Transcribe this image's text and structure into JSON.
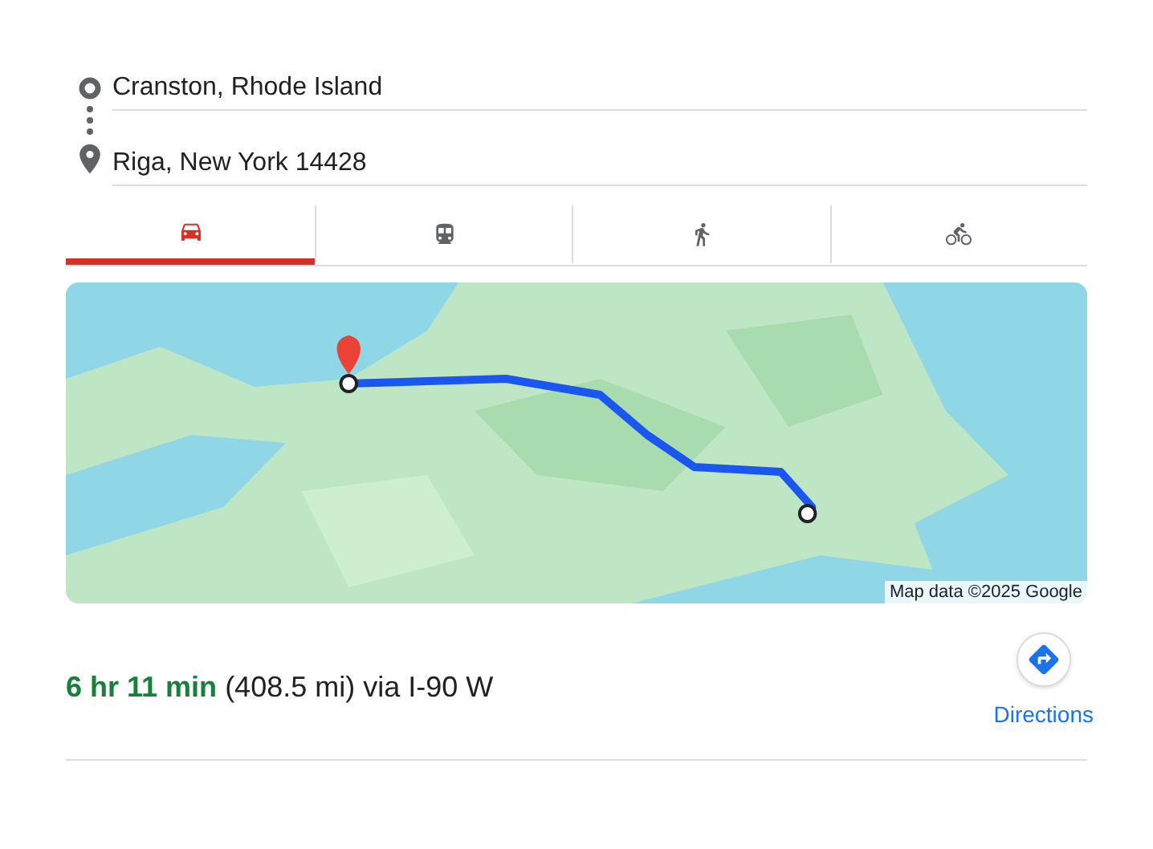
{
  "origin": {
    "value": "Cranston, Rhode Island"
  },
  "destination": {
    "value": "Riga, New York 14428"
  },
  "modes": [
    {
      "kind": "car",
      "selected": true
    },
    {
      "kind": "transit",
      "selected": false
    },
    {
      "kind": "walk",
      "selected": false
    },
    {
      "kind": "bike",
      "selected": false
    }
  ],
  "map": {
    "kind": "picture",
    "attribution": "Map data ©2025 Google"
  },
  "route": {
    "duration": "6 hr 11 min",
    "details": "(408.5 mi) via I-90 W"
  },
  "directions_button": {
    "label": "Directions"
  }
}
